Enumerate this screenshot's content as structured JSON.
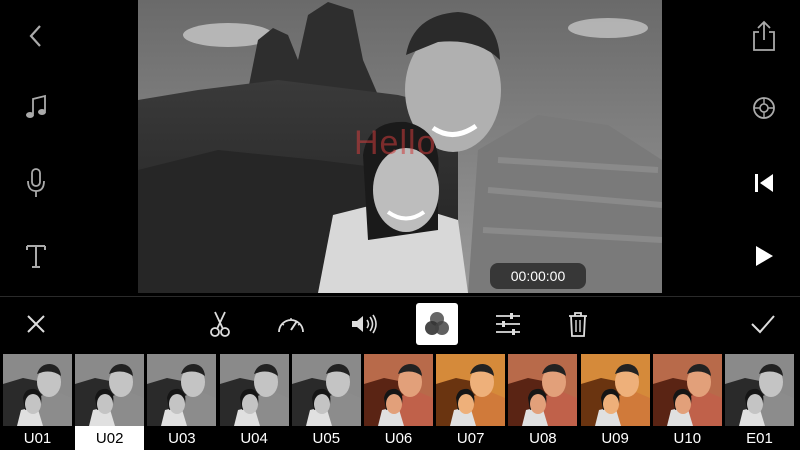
{
  "rail_left": {
    "buttons": [
      {
        "name": "back-icon"
      },
      {
        "name": "music-icon"
      },
      {
        "name": "microphone-icon"
      },
      {
        "name": "text-icon"
      }
    ]
  },
  "rail_right": {
    "buttons": [
      {
        "name": "share-icon"
      },
      {
        "name": "settings-icon"
      },
      {
        "name": "skip-to-start-icon"
      },
      {
        "name": "play-icon"
      }
    ]
  },
  "preview": {
    "overlay_text": "Hello",
    "timecode": "00:00:00",
    "filter": "grayscale"
  },
  "toolbar": {
    "tools": [
      "close-icon",
      "scissors-icon",
      "speedometer-icon",
      "volume-icon",
      "color-filter-icon",
      "adjust-sliders-icon",
      "trash-icon",
      "checkmark-icon"
    ],
    "active_tool": "color-filter-icon"
  },
  "filters": {
    "selected": "U02",
    "items": [
      {
        "label": "U01",
        "tone": "bw"
      },
      {
        "label": "U02",
        "tone": "bw"
      },
      {
        "label": "U03",
        "tone": "bw"
      },
      {
        "label": "U04",
        "tone": "bw"
      },
      {
        "label": "U05",
        "tone": "bw"
      },
      {
        "label": "U06",
        "tone": "warm-red"
      },
      {
        "label": "U07",
        "tone": "warm-orange"
      },
      {
        "label": "U08",
        "tone": "warm-red"
      },
      {
        "label": "U09",
        "tone": "warm-orange"
      },
      {
        "label": "U10",
        "tone": "warm-red"
      },
      {
        "label": "E01",
        "tone": "bw"
      }
    ]
  },
  "colors": {
    "background": "#000000",
    "overlay_text": "#cd3c3c",
    "active_tool_bg": "#ffffff"
  }
}
